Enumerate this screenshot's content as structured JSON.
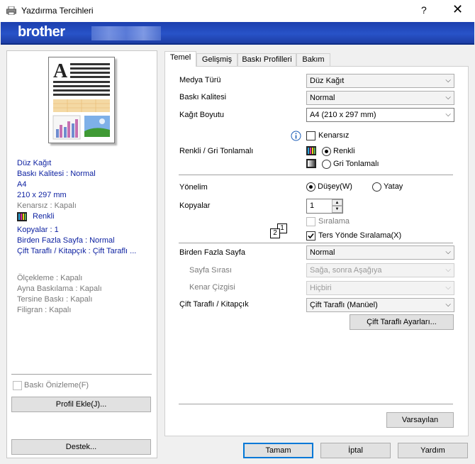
{
  "window": {
    "title": "Yazdırma Tercihleri",
    "help": "?",
    "close": "✕"
  },
  "banner": {
    "logo": "brother"
  },
  "left": {
    "summary_blue": [
      "Düz Kağıt",
      "Baskı Kalitesi : Normal",
      "A4",
      "210 x 297 mm"
    ],
    "borderless": "Kenarsız : Kapalı",
    "color_label": "Renkli",
    "summary_blue2": [
      "Kopyalar : 1",
      "Birden Fazla Sayfa : Normal",
      "Çift Taraflı / Kitapçık : Çift Taraflı ..."
    ],
    "summary_grey": [
      "Ölçekleme : Kapalı",
      "Ayna Baskılama : Kapalı",
      "Tersine Baskı : Kapalı",
      "Filigran : Kapalı"
    ],
    "preview_check": "Baskı Önizleme(F)",
    "add_profile": "Profil Ekle(J)...",
    "support": "Destek..."
  },
  "tabs": [
    "Temel",
    "Gelişmiş",
    "Baskı Profilleri",
    "Bakım"
  ],
  "basic": {
    "media_label": "Medya Türü",
    "media_value": "Düz Kağıt",
    "quality_label": "Baskı Kalitesi",
    "quality_value": "Normal",
    "size_label": "Kağıt Boyutu",
    "size_value": "A4 (210 x 297 mm)",
    "borderless_label": "Kenarsız",
    "color_mode_label": "Renkli / Gri Tonlamalı",
    "color_option": "Renkli",
    "gray_option": "Gri Tonlamalı",
    "orientation_label": "Yönelim",
    "portrait": "Düşey(W)",
    "landscape": "Yatay",
    "copies_label": "Kopyalar",
    "copies_value": "1",
    "collate": "Sıralama",
    "reverse_order": "Ters Yönde Sıralama(X)",
    "reverse_icon_front": "1",
    "reverse_icon_back": "2",
    "multi_page_label": "Birden Fazla Sayfa",
    "multi_page_value": "Normal",
    "page_order_label": "Sayfa Sırası",
    "page_order_value": "Sağa, sonra Aşağıya",
    "border_line_label": "Kenar Çizgisi",
    "border_line_value": "Hiçbiri",
    "duplex_label": "Çift Taraflı / Kitapçık",
    "duplex_value": "Çift Taraflı (Manüel)",
    "duplex_settings": "Çift Taraflı Ayarları...",
    "defaults": "Varsayılan"
  },
  "footer": {
    "ok": "Tamam",
    "cancel": "İptal",
    "help": "Yardım"
  },
  "colors": {
    "banner": "#2853c8",
    "summary_blue": "#0b1fa0",
    "focus": "#0078d7"
  }
}
